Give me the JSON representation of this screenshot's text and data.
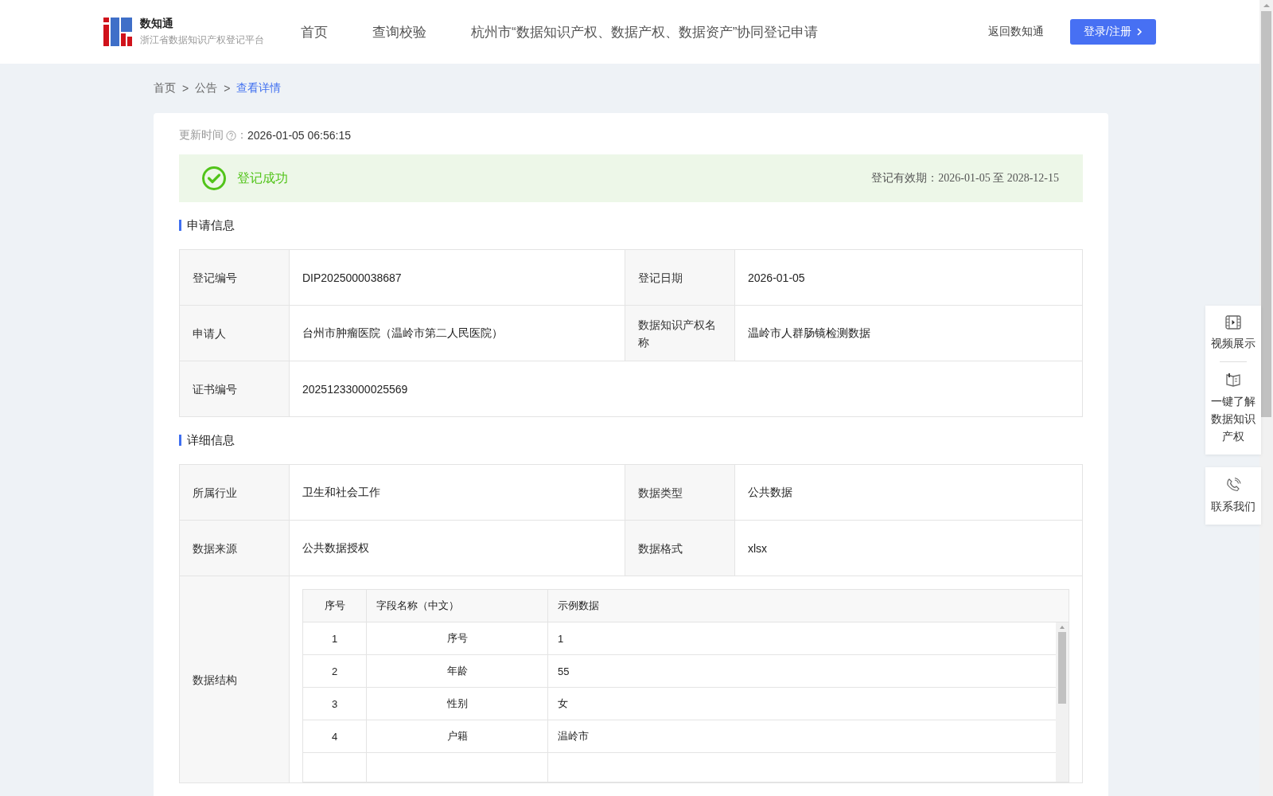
{
  "header": {
    "logo": {
      "title": "数知通",
      "subtitle": "浙江省数据知识产权登记平台"
    },
    "nav": [
      {
        "label": "首页",
        "selected": false
      },
      {
        "label": "查询校验",
        "selected": false
      },
      {
        "label": "杭州市“数据知识产权、数据产权、数据资产”协同登记申请",
        "selected": false
      }
    ],
    "back_link": "返回数知通",
    "login_button": "登录/注册"
  },
  "breadcrumb": [
    {
      "label": "首页",
      "selected": false
    },
    {
      "label": "公告",
      "selected": false
    },
    {
      "label": "查看详情",
      "selected": true
    }
  ],
  "breadcrumb_separator": ">",
  "update": {
    "label": "更新时间",
    "colon": "：",
    "value": "2026-01-05 06:56:15"
  },
  "status": {
    "text": "登记成功",
    "validity_label": "登记有效期：",
    "start": "2026-01-05",
    "to": "至",
    "end": "2028-12-15"
  },
  "apply_info": {
    "title": "申请信息",
    "rows": [
      [
        {
          "label": "登记编号",
          "value": "DIP2025000038687"
        },
        {
          "label": "登记日期",
          "value": "2026-01-05"
        }
      ],
      [
        {
          "label": "申请人",
          "value": "台州市肿瘤医院（温岭市第二人民医院）"
        },
        {
          "label": "数据知识产权名称",
          "value": "温岭市人群肠镜检测数据"
        }
      ],
      [
        {
          "label": "证书编号",
          "value": "20251233000025569"
        }
      ]
    ]
  },
  "detail_info": {
    "title": "详细信息",
    "rows": [
      [
        {
          "label": "所属行业",
          "value": "卫生和社会工作"
        },
        {
          "label": "数据类型",
          "value": "公共数据"
        }
      ],
      [
        {
          "label": "数据来源",
          "value": "公共数据授权"
        },
        {
          "label": "数据格式",
          "value": "xlsx"
        }
      ]
    ],
    "structure": {
      "label": "数据结构",
      "columns": [
        "序号",
        "字段名称（中文）",
        "示例数据"
      ],
      "rows": [
        {
          "no": "1",
          "field": "序号",
          "sample": "1"
        },
        {
          "no": "2",
          "field": "年龄",
          "sample": "55"
        },
        {
          "no": "3",
          "field": "性别",
          "sample": "女"
        },
        {
          "no": "4",
          "field": "户籍",
          "sample": "温岭市"
        }
      ]
    }
  },
  "side_panel": [
    {
      "kind": "video",
      "label": "视频展示"
    },
    {
      "kind": "book",
      "label": "一键了解数据知识产权"
    }
  ],
  "contact": {
    "kind": "phone",
    "label": "联系我们"
  }
}
